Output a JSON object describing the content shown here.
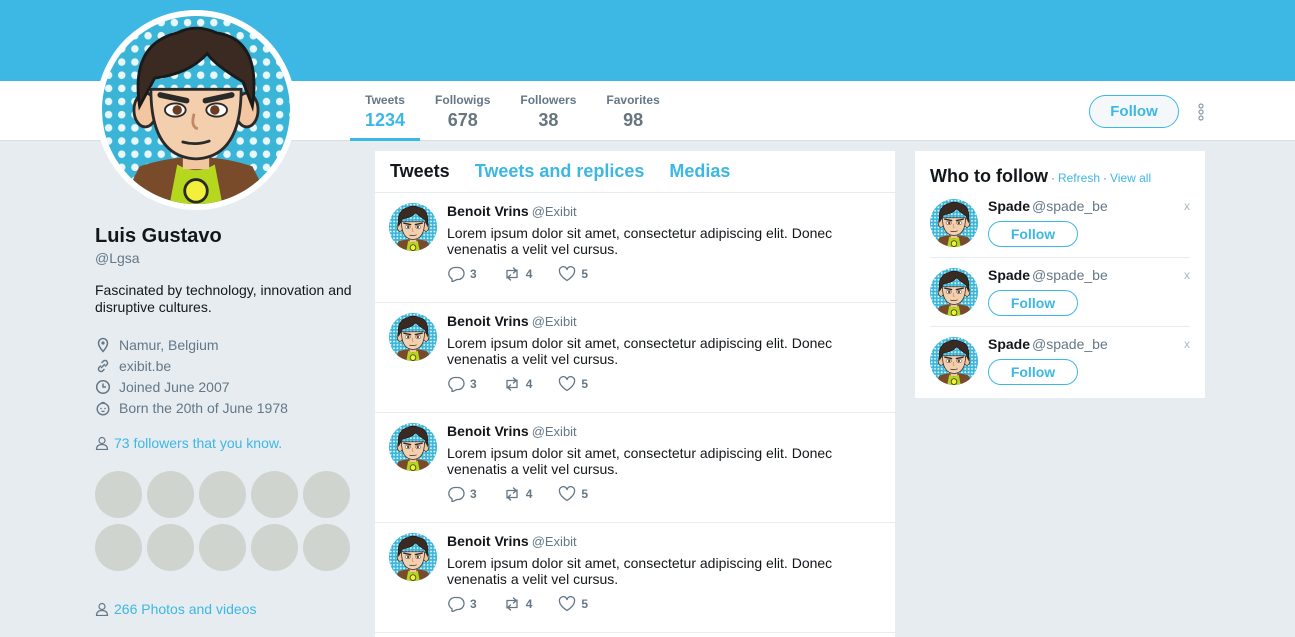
{
  "colors": {
    "brand": "#3db7e4",
    "background": "#e6ecf0",
    "muted": "#657786"
  },
  "stats": [
    {
      "label": "Tweets",
      "value": "1234",
      "active": true
    },
    {
      "label": "Followigs",
      "value": "678"
    },
    {
      "label": "Followers",
      "value": "38"
    },
    {
      "label": "Favorites",
      "value": "98"
    }
  ],
  "header": {
    "follow_label": "Follow",
    "more_icon": "vertical-dots-icon"
  },
  "profile": {
    "name": "Luis Gustavo",
    "handle": "@Lgsa",
    "bio": "Fascinated by technology, innovation and disruptive cultures.",
    "location": "Namur, Belgium",
    "website": "exibit.be",
    "joined": "Joined June 2007",
    "born": "Born the 20th of June 1978",
    "followers_known": "73 followers that you know.",
    "photos": "266 Photos and videos"
  },
  "tabs": [
    "Tweets",
    "Tweets and replices",
    "Medias"
  ],
  "tweets": [
    {
      "name": "Benoit Vrins",
      "handle": "@Exibit",
      "text": "Lorem ipsum dolor sit amet, consectetur adipiscing elit. Donec venenatis a velit vel cursus.",
      "replies": "3",
      "retweets": "4",
      "likes": "5"
    },
    {
      "name": "Benoit Vrins",
      "handle": "@Exibit",
      "text": "Lorem ipsum dolor sit amet, consectetur adipiscing elit. Donec venenatis a velit vel cursus.",
      "replies": "3",
      "retweets": "4",
      "likes": "5"
    },
    {
      "name": "Benoit Vrins",
      "handle": "@Exibit",
      "text": "Lorem ipsum dolor sit amet, consectetur adipiscing elit. Donec venenatis a velit vel cursus.",
      "replies": "3",
      "retweets": "4",
      "likes": "5"
    },
    {
      "name": "Benoit Vrins",
      "handle": "@Exibit",
      "text": "Lorem ipsum dolor sit amet, consectetur adipiscing elit. Donec venenatis a velit vel cursus.",
      "replies": "3",
      "retweets": "4",
      "likes": "5"
    }
  ],
  "who_to_follow": {
    "title": "Who to follow",
    "separator": "·",
    "refresh": "Refresh",
    "view_all": "View all",
    "suggestions": [
      {
        "name": "Spade",
        "handle": "@spade_be",
        "follow_label": "Follow",
        "close": "x"
      },
      {
        "name": "Spade",
        "handle": "@spade_be",
        "follow_label": "Follow",
        "close": "x"
      },
      {
        "name": "Spade",
        "handle": "@spade_be",
        "follow_label": "Follow",
        "close": "x"
      }
    ]
  }
}
